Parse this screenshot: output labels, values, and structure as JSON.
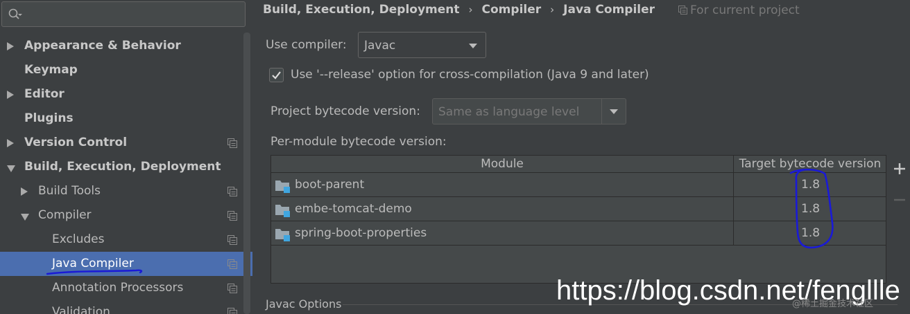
{
  "sidebar": {
    "search": {
      "value": "",
      "placeholder": ""
    },
    "items": [
      {
        "label": "Appearance & Behavior",
        "arrow": "right",
        "bold": true,
        "scope_icon": false
      },
      {
        "label": "Keymap",
        "arrow": "none",
        "bold": true,
        "scope_icon": false
      },
      {
        "label": "Editor",
        "arrow": "right",
        "bold": true,
        "scope_icon": false
      },
      {
        "label": "Plugins",
        "arrow": "none",
        "bold": true,
        "scope_icon": false
      },
      {
        "label": "Version Control",
        "arrow": "right",
        "bold": true,
        "scope_icon": true
      },
      {
        "label": "Build, Execution, Deployment",
        "arrow": "down",
        "bold": true,
        "scope_icon": false
      },
      {
        "label": "Build Tools",
        "arrow": "right",
        "bold": false,
        "scope_icon": true
      },
      {
        "label": "Compiler",
        "arrow": "down",
        "bold": false,
        "scope_icon": true
      },
      {
        "label": "Excludes",
        "arrow": "none",
        "bold": false,
        "scope_icon": true
      },
      {
        "label": "Java Compiler",
        "arrow": "none",
        "bold": false,
        "scope_icon": true,
        "selected": true
      },
      {
        "label": "Annotation Processors",
        "arrow": "none",
        "bold": false,
        "scope_icon": true
      },
      {
        "label": "Validation",
        "arrow": "none",
        "bold": false,
        "scope_icon": true
      }
    ]
  },
  "breadcrumb": {
    "items": [
      "Build, Execution, Deployment",
      "Compiler",
      "Java Compiler"
    ],
    "separator": "›"
  },
  "scope_note": "For current project",
  "use_compiler": {
    "label": "Use compiler:",
    "value": "Javac"
  },
  "release_option": {
    "checked": true,
    "label": "Use '--release' option for cross-compilation (Java 9 and later)"
  },
  "project_bytecode": {
    "label": "Project bytecode version:",
    "placeholder": "Same as language level"
  },
  "per_module_label": "Per-module bytecode version:",
  "module_table": {
    "columns": [
      "Module",
      "Target bytecode version"
    ],
    "rows": [
      {
        "module": "boot-parent",
        "version": "1.8"
      },
      {
        "module": "embe-tomcat-demo",
        "version": "1.8"
      },
      {
        "module": "spring-boot-properties",
        "version": "1.8"
      }
    ]
  },
  "javac_options_label": "Javac Options",
  "watermark": {
    "url": "https://blog.csdn.net/fengllle",
    "sub": "@稀土掘金技术社区"
  },
  "colors": {
    "background": "#3c3f41",
    "selection": "#4b6eaf",
    "text": "#bbbbbb",
    "annotation_pen": "#1a1ad6",
    "module_icon_accent": "#40a6e0"
  }
}
